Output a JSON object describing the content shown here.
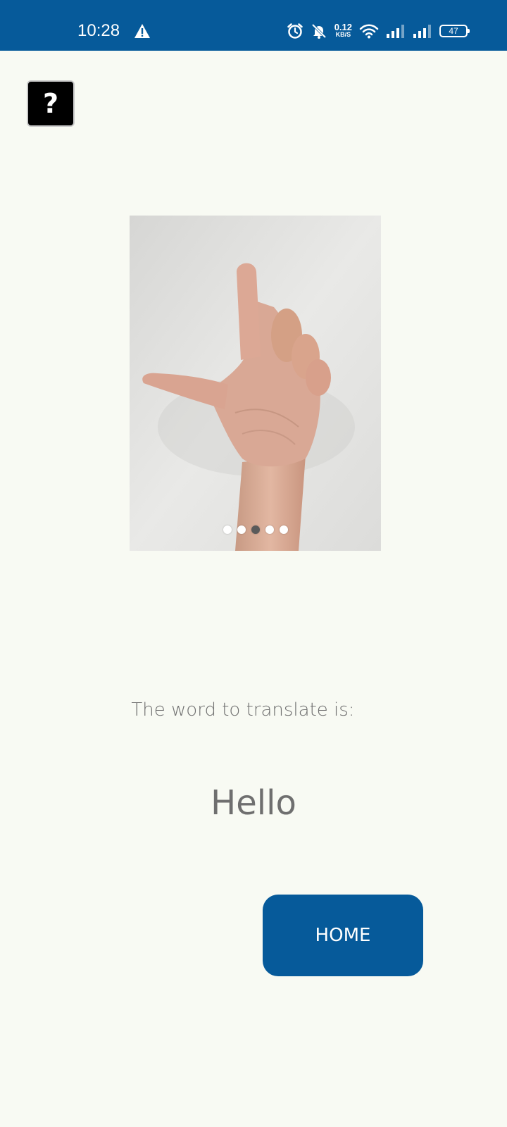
{
  "status_bar": {
    "time": "10:28",
    "net_speed_value": "0.12",
    "net_speed_unit": "KB/S",
    "battery_level": "47",
    "icons": [
      "warning-icon",
      "alarm-icon",
      "bell-muted-icon",
      "wifi-icon",
      "signal-icon",
      "signal-icon",
      "battery-icon"
    ]
  },
  "help_button": {
    "label": "?"
  },
  "carousel": {
    "dot_count": 5,
    "active_index": 2
  },
  "prompt": {
    "label": "The word to translate is:",
    "word": "Hello"
  },
  "home_button": {
    "label": "HOME"
  },
  "colors": {
    "primary": "#065a9a",
    "background": "#f8faf3",
    "text_muted": "#707070"
  }
}
